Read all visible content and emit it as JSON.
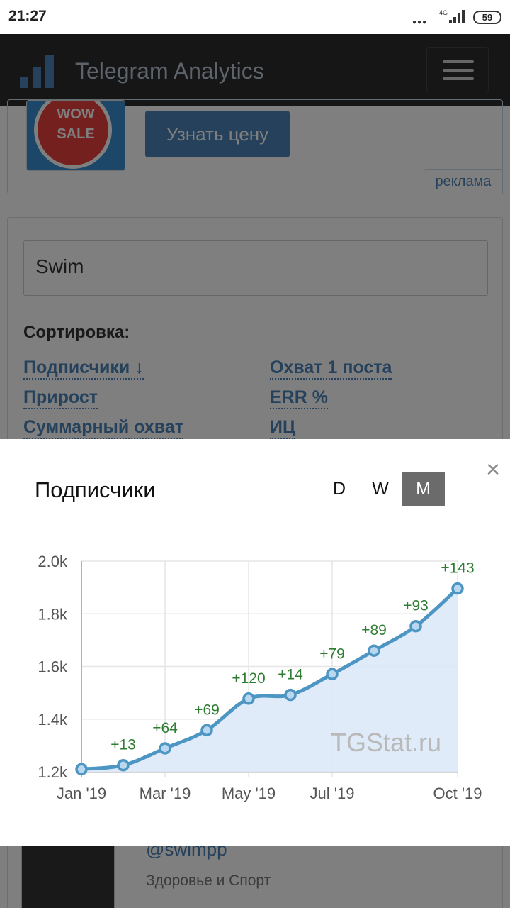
{
  "status_bar": {
    "time": "21:27",
    "network": "4G",
    "battery": "59"
  },
  "navbar": {
    "title": "Telegram Analytics"
  },
  "ad": {
    "button_label": "Узнать цену",
    "tag": "реклама",
    "image_text_1": "WOW",
    "image_text_2": "SALE"
  },
  "search": {
    "value": "Swim"
  },
  "sort": {
    "title": "Сортировка:",
    "links": [
      "Подписчики ↓",
      "Охват 1 поста",
      "Прирост",
      "ERR %",
      "Суммарный охват",
      "ИЦ"
    ]
  },
  "channel": {
    "handle": "@swimpp",
    "category": "Здоровье и Спорт"
  },
  "modal": {
    "title": "Подписчики",
    "periods": [
      "D",
      "W",
      "M"
    ],
    "active_period": "M",
    "close_icon": "close-icon"
  },
  "chart_data": {
    "type": "area",
    "watermark": "TGStat.ru",
    "x": [
      "2019-01",
      "2019-02",
      "2019-03",
      "2019-04",
      "2019-05",
      "2019-06",
      "2019-07",
      "2019-08",
      "2019-09",
      "2019-10"
    ],
    "x_ticks": [
      "Jan '19",
      "Mar '19",
      "May '19",
      "Jul '19",
      "Oct '19"
    ],
    "series": [
      {
        "values": [
          1210,
          1225,
          1289,
          1358,
          1478,
          1492,
          1571,
          1660,
          1753,
          1896
        ],
        "labels": [
          "",
          "+13",
          "+64",
          "+69",
          "+120",
          "+14",
          "+79",
          "+89",
          "+93",
          "+143"
        ]
      }
    ],
    "y_ticks": [
      "1.2k",
      "1.4k",
      "1.6k",
      "1.8k",
      "2.0k"
    ],
    "ylim": [
      1200,
      2000
    ],
    "grid": true,
    "colors": {
      "line": "#4d96c4",
      "fill": "#dce9f8",
      "label": "#2e7d32"
    }
  }
}
